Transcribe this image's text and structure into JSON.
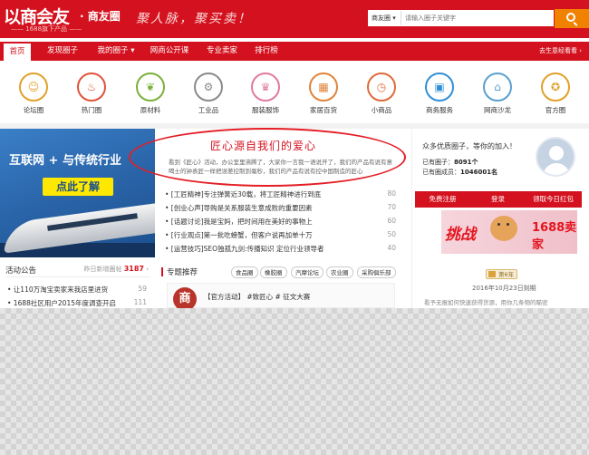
{
  "header": {
    "logo": "以商会友",
    "logo_sub": "· 商友圈",
    "logo_tag": "—— 1688旗下产品 ——",
    "slogan": "聚人脉，聚买卖！",
    "search_select": "商友圈 ▾",
    "search_placeholder": "请输入圈子关键字"
  },
  "nav": {
    "items": [
      "首页",
      "发现圈子",
      "我的圈子 ▾",
      "网商公开课",
      "专业卖家",
      "排行榜"
    ],
    "right": "去生意经看看 ›"
  },
  "categories": [
    {
      "label": "论坛圈",
      "icon": "people-icon",
      "glyph": "☺",
      "color": "#e0a12a"
    },
    {
      "label": "热门圈",
      "icon": "flame-icon",
      "glyph": "♨",
      "color": "#e0523a"
    },
    {
      "label": "原材料",
      "icon": "leaf-icon",
      "glyph": "❦",
      "color": "#7bb03a"
    },
    {
      "label": "工业品",
      "icon": "gear-icon",
      "glyph": "⚙",
      "color": "#8a8a8a"
    },
    {
      "label": "服装服饰",
      "icon": "dress-icon",
      "glyph": "♛",
      "color": "#e07aa0"
    },
    {
      "label": "家居百货",
      "icon": "sofa-icon",
      "glyph": "▦",
      "color": "#e0833a"
    },
    {
      "label": "小商品",
      "icon": "clock-icon",
      "glyph": "◷",
      "color": "#e06a3a"
    },
    {
      "label": "商务服务",
      "icon": "briefcase-icon",
      "glyph": "▣",
      "color": "#2f8fd6"
    },
    {
      "label": "网商沙龙",
      "icon": "laptop-icon",
      "glyph": "⌂",
      "color": "#5aa0d0"
    },
    {
      "label": "官方圈",
      "icon": "badge-icon",
      "glyph": "✪",
      "color": "#e0a12a"
    }
  ],
  "banner": {
    "line1": "互联网 + 与传统行业",
    "button": "点此了解"
  },
  "activity": {
    "title": "活动公告",
    "count_label": "昨日新增圈帖",
    "count": "3187",
    "items": [
      {
        "text": "• 让110万淘宝卖家来我店里进货",
        "num": "59"
      },
      {
        "text": "• 1688社区用户2015年度调查开启",
        "num": "111"
      }
    ]
  },
  "feature": {
    "title": "匠心源自我们的爱心",
    "desc": "看到《匠心》活动，办公室里沸腾了，大家你一言我一语说开了，我们的产品有说有意喝士的钟表匠一样把误差控制到毫秒，我们的产品有说有控中国制造的匠心"
  },
  "news": [
    {
      "text": "• [工匠精神]专注弹簧近30载，将工匠精神进行到底",
      "num": "80"
    },
    {
      "text": "• [创业心声]导购是关系服装生意成败的重要因素",
      "num": "70"
    },
    {
      "text": "• [话题讨论]我是宝妈，把时间用在美好的事物上",
      "num": "60"
    },
    {
      "text": "• [行业观点]第一批吃螃蟹，但客户说再加单十万",
      "num": "50"
    },
    {
      "text": "• [运营技巧]SEO独孤九剑:传播知识 定位行业领导者",
      "num": "40"
    }
  ],
  "topics": {
    "title": "专题推荐",
    "tags": [
      "食品圈",
      "橡胶圈",
      "汽摩论坛",
      "农业圈",
      "采购俱乐部"
    ],
    "card_avatar": "商",
    "card_text": "【官方活动】 #致匠心 # 征文大赛"
  },
  "right": {
    "intro": "众多优质圈子，等你的加入！",
    "stat1_label": "已有圈子：",
    "stat1": "8091个",
    "stat2_label": "已有圈成员：",
    "stat2": "1046001名",
    "buttons": [
      "免费注册",
      "登录",
      "领取今日红包"
    ],
    "promo_text": "挑战",
    "promo_text2": "1688卖家",
    "badge": "第6年",
    "date": "2016年10月23日刻期",
    "msg": "看予无报如何快速获得货源，用你几条物的瞄密"
  }
}
